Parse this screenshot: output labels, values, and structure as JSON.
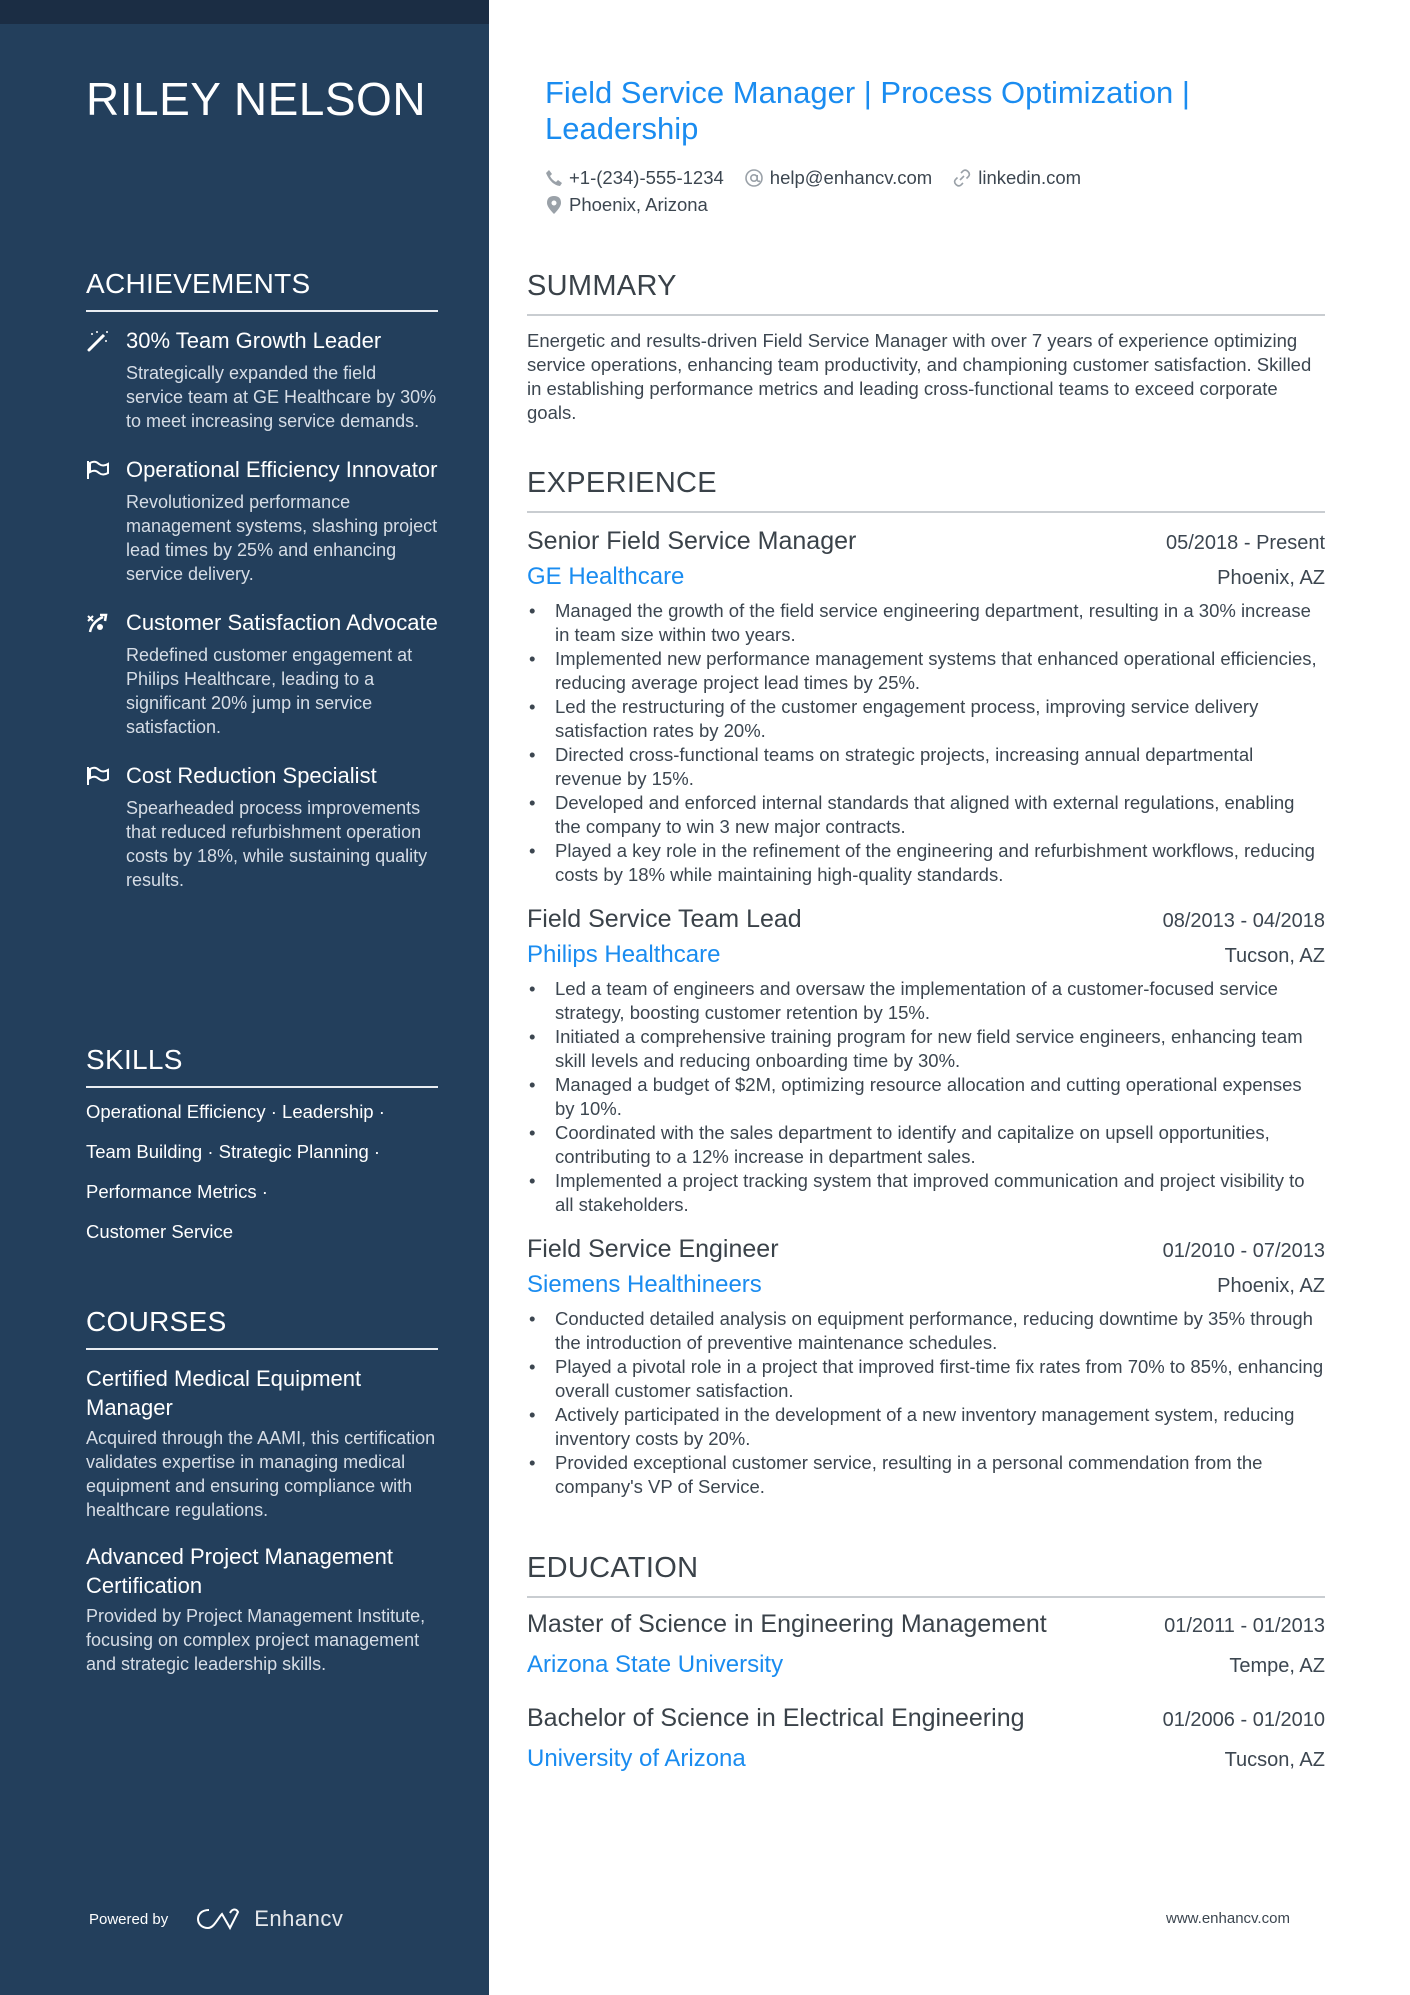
{
  "name": "RILEY NELSON",
  "headline": "Field Service Manager | Process Optimization | Leadership",
  "contacts": {
    "phone": {
      "icon": "phone-icon",
      "value": "+1-(234)-555-1234"
    },
    "email": {
      "icon": "at-icon",
      "value": "help@enhancv.com"
    },
    "link": {
      "icon": "link-icon",
      "value": "linkedin.com"
    },
    "location": {
      "icon": "location-pin-icon",
      "value": "Phoenix, Arizona"
    }
  },
  "sidebar": {
    "achievements_heading": "ACHIEVEMENTS",
    "achievements": [
      {
        "icon": "magic-wand-icon",
        "title": "30% Team Growth Leader",
        "description": "Strategically expanded the field service team at GE Healthcare by 30% to meet increasing service demands."
      },
      {
        "icon": "flag-icon",
        "title": "Operational Efficiency Innovator",
        "description": "Revolutionized performance management systems, slashing project lead times by 25% and enhancing service delivery."
      },
      {
        "icon": "strategy-icon",
        "title": "Customer Satisfaction Advocate",
        "description": "Redefined customer engagement at Philips Healthcare, leading to a significant 20% jump in service satisfaction."
      },
      {
        "icon": "flag-icon",
        "title": "Cost Reduction Specialist",
        "description": "Spearheaded process improvements that reduced refurbishment operation costs by 18%, while sustaining quality results."
      }
    ],
    "skills_heading": "SKILLS",
    "skills_lines": [
      "Operational Efficiency · Leadership ·",
      "Team Building · Strategic Planning ·",
      "Performance Metrics ·",
      "Customer Service"
    ],
    "courses_heading": "COURSES",
    "courses": [
      {
        "title": "Certified Medical Equipment Manager",
        "description": "Acquired through the AAMI, this certification validates expertise in managing medical equipment and ensuring compliance with healthcare regulations."
      },
      {
        "title": "Advanced Project Management Certification",
        "description": "Provided by Project Management Institute, focusing on complex project management and strategic leadership skills."
      }
    ],
    "powered_by": "Powered by",
    "brand": "Enhancv"
  },
  "summary": {
    "heading": "SUMMARY",
    "text": "Energetic and results-driven Field Service Manager with over 7 years of experience optimizing service operations, enhancing team productivity, and championing customer satisfaction. Skilled in establishing performance metrics and leading cross-functional teams to exceed corporate goals."
  },
  "experience": {
    "heading": "EXPERIENCE",
    "jobs": [
      {
        "title": "Senior Field Service Manager",
        "dates": "05/2018 - Present",
        "company": "GE Healthcare",
        "location": "Phoenix, AZ",
        "bullets": [
          "Managed the growth of the field service engineering department, resulting in a 30% increase in team size within two years.",
          "Implemented new performance management systems that enhanced operational efficiencies, reducing average project lead times by 25%.",
          "Led the restructuring of the customer engagement process, improving service delivery satisfaction rates by 20%.",
          "Directed cross-functional teams on strategic projects, increasing annual departmental revenue by 15%.",
          "Developed and enforced internal standards that aligned with external regulations, enabling the company to win 3 new major contracts.",
          "Played a key role in the refinement of the engineering and refurbishment workflows, reducing costs by 18% while maintaining high-quality standards."
        ]
      },
      {
        "title": "Field Service Team Lead",
        "dates": "08/2013 - 04/2018",
        "company": "Philips Healthcare",
        "location": "Tucson, AZ",
        "bullets": [
          "Led a team of engineers and oversaw the implementation of a customer-focused service strategy, boosting customer retention by 15%.",
          "Initiated a comprehensive training program for new field service engineers, enhancing team skill levels and reducing onboarding time by 30%.",
          "Managed a budget of $2M, optimizing resource allocation and cutting operational expenses by 10%.",
          "Coordinated with the sales department to identify and capitalize on upsell opportunities, contributing to a 12% increase in department sales.",
          "Implemented a project tracking system that improved communication and project visibility to all stakeholders."
        ]
      },
      {
        "title": "Field Service Engineer",
        "dates": "01/2010 - 07/2013",
        "company": "Siemens Healthineers",
        "location": "Phoenix, AZ",
        "bullets": [
          "Conducted detailed analysis on equipment performance, reducing downtime by 35% through the introduction of preventive maintenance schedules.",
          "Played a pivotal role in a project that improved first-time fix rates from 70% to 85%, enhancing overall customer satisfaction.",
          "Actively participated in the development of a new inventory management system, reducing inventory costs by 20%.",
          "Provided exceptional customer service, resulting in a personal commendation from the company's VP of Service."
        ]
      }
    ]
  },
  "education": {
    "heading": "EDUCATION",
    "items": [
      {
        "degree": "Master of Science in Engineering Management",
        "dates": "01/2011 - 01/2013",
        "school": "Arizona State University",
        "location": "Tempe, AZ"
      },
      {
        "degree": "Bachelor of Science in Electrical Engineering",
        "dates": "01/2006 - 01/2010",
        "school": "University of Arizona",
        "location": "Tucson, AZ"
      }
    ]
  },
  "footer_url": "www.enhancv.com",
  "colors": {
    "sidebar": "#233f5c",
    "accent": "#1a8cf0",
    "text": "#3c4650"
  }
}
